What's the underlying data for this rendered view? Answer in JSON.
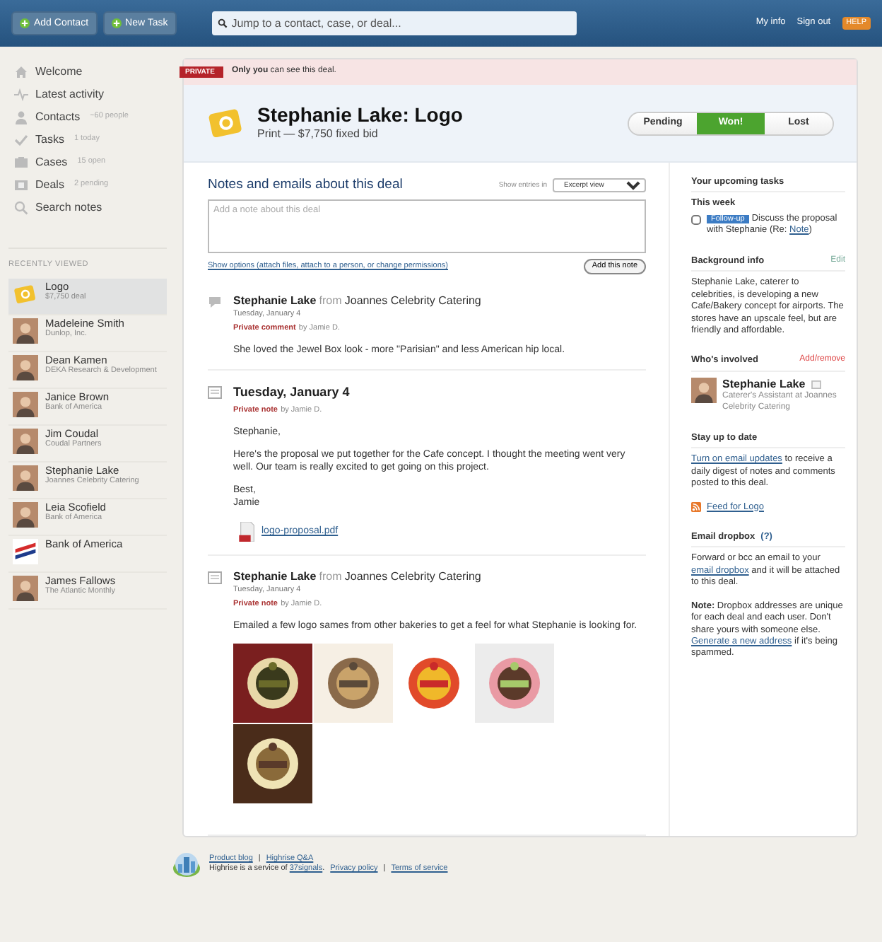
{
  "topbar": {
    "buttons": [
      {
        "label": "Add Contact"
      },
      {
        "label": "New Task"
      }
    ],
    "search": {
      "placeholder": "Jump to a contact, case, or deal..."
    },
    "links": [
      "My info",
      "Sign out"
    ],
    "help": "HELP"
  },
  "sidebar": {
    "nav": [
      {
        "kind": "home",
        "label": "Welcome"
      },
      {
        "kind": "activity",
        "label": "Latest activity"
      },
      {
        "kind": "person",
        "label": "Contacts",
        "count": "~60 people"
      },
      {
        "kind": "check",
        "label": "Tasks",
        "count": "1 today"
      },
      {
        "kind": "case",
        "label": "Cases",
        "count": "15 open"
      },
      {
        "kind": "deal",
        "label": "Deals",
        "count": "2 pending"
      },
      {
        "kind": "search",
        "label": "Search notes"
      }
    ],
    "recent_heading": "RECENTLY VIEWED",
    "recent": [
      {
        "kind": "deal",
        "name": "Logo",
        "detail": "$7,750 deal",
        "selected": true
      },
      {
        "kind": "person",
        "name": "Madeleine Smith",
        "detail": "Dunlop, Inc.",
        "selected": false
      },
      {
        "kind": "person",
        "name": "Dean Kamen",
        "detail": "DEKA Research & Development",
        "selected": false
      },
      {
        "kind": "person",
        "name": "Janice Brown",
        "detail": "Bank of America",
        "selected": false
      },
      {
        "kind": "person",
        "name": "Jim Coudal",
        "detail": "Coudal Partners",
        "selected": false
      },
      {
        "kind": "person",
        "name": "Stephanie Lake",
        "detail": "Joannes Celebrity Catering",
        "selected": false
      },
      {
        "kind": "person",
        "name": "Leia Scofield",
        "detail": "Bank of America",
        "selected": false
      },
      {
        "kind": "company",
        "name": "Bank of America",
        "selected": false
      },
      {
        "kind": "person",
        "name": "James Fallows",
        "detail": "The Atlantic Monthly",
        "selected": false
      }
    ]
  },
  "banner": {
    "tag": "PRIVATE",
    "text": "**Only you** can see this deal."
  },
  "deal": {
    "title": "Stephanie Lake: Logo",
    "subtitle": "Print — $7,750 fixed bid",
    "status": [
      {
        "label": "Pending",
        "selected": false
      },
      {
        "label": "Won!",
        "selected": true
      },
      {
        "label": "Lost",
        "selected": false
      }
    ]
  },
  "notes": {
    "heading": "Notes and emails about this deal",
    "show_label": "Show entries in",
    "view": "Excerpt view",
    "placeholder": "Add a note about this deal",
    "options_link": "Show options (attach files, attach to a person, or change permissions)",
    "add_button": "Add this note",
    "entries": [
      {
        "kind": "comment",
        "author": "Stephanie Lake",
        "from": "from",
        "company": "Joannes Celebrity Catering",
        "date": "Tuesday, January 4",
        "privacy": "Private comment",
        "by": "by Jamie D.",
        "body": [
          "She loved the Jewel Box look - more \"Parisian\" and less American hip local."
        ]
      },
      {
        "kind": "note",
        "title": "Tuesday, January 4",
        "privacy": "Private note",
        "by": "by Jamie D.",
        "body": [
          "Stephanie,",
          "Here's the proposal we put together for the Cafe concept. I thought the meeting went very well. Our team is really excited to get going on this project.",
          "Best,\nJamie"
        ],
        "attachment": "logo-proposal.pdf"
      },
      {
        "kind": "note",
        "author": "Stephanie Lake",
        "from": "from",
        "company": "Joannes Celebrity Catering",
        "date": "Tuesday, January 4",
        "privacy": "Private note",
        "by": "by Jamie D.",
        "body": [
          "Emailed a few logo sames from other bakeries to get a feel for what Stephanie is looking for."
        ],
        "images": [
          {
            "kind": "picture"
          },
          {
            "kind": "picture"
          },
          {
            "kind": "picture"
          },
          {
            "kind": "picture"
          },
          {
            "kind": "picture"
          }
        ]
      }
    ]
  },
  "aside": {
    "tasks": {
      "heading": "Your upcoming tasks",
      "period": "This week",
      "items": [
        {
          "checked": false,
          "tag": "Follow-up",
          "text": "Discuss the proposal with Stephanie (Re:",
          "link": "Note",
          "after": ")"
        }
      ]
    },
    "background": {
      "heading": "Background info",
      "edit": "Edit",
      "text": "Stephanie Lake, caterer to celebrities, is developing a new Cafe/Bakery concept for airports. The stores have an upscale feel, but are friendly and affordable."
    },
    "involved": {
      "heading": "Who's involved",
      "action": "Add/remove",
      "people": [
        {
          "name": "Stephanie Lake",
          "role": "Caterer's Assistant at Joannes Celebrity Catering"
        }
      ]
    },
    "updates": {
      "heading": "Stay up to date",
      "link": "Turn on email updates",
      "after": " to receive a daily digest of notes and comments posted to this deal.",
      "feed": "Feed for Logo"
    },
    "dropbox": {
      "heading": "Email dropbox",
      "help": "(?)",
      "before": "Forward or bcc an email to your ",
      "link": "email dropbox",
      "after": " and it will be attached to this deal.",
      "note": "**Note:** Dropbox addresses are unique for each deal and each user. Don't share yours with someone else. ",
      "note_link": "Generate a new address",
      "note_after": " if it's being spammed."
    }
  },
  "footer": {
    "links": [
      "Product blog",
      "Highrise Q&A"
    ],
    "separator": "|",
    "service": "Highrise is a service of ",
    "company": "37signals",
    "period": ".",
    "legal": [
      "Privacy policy",
      "Terms of service"
    ]
  }
}
